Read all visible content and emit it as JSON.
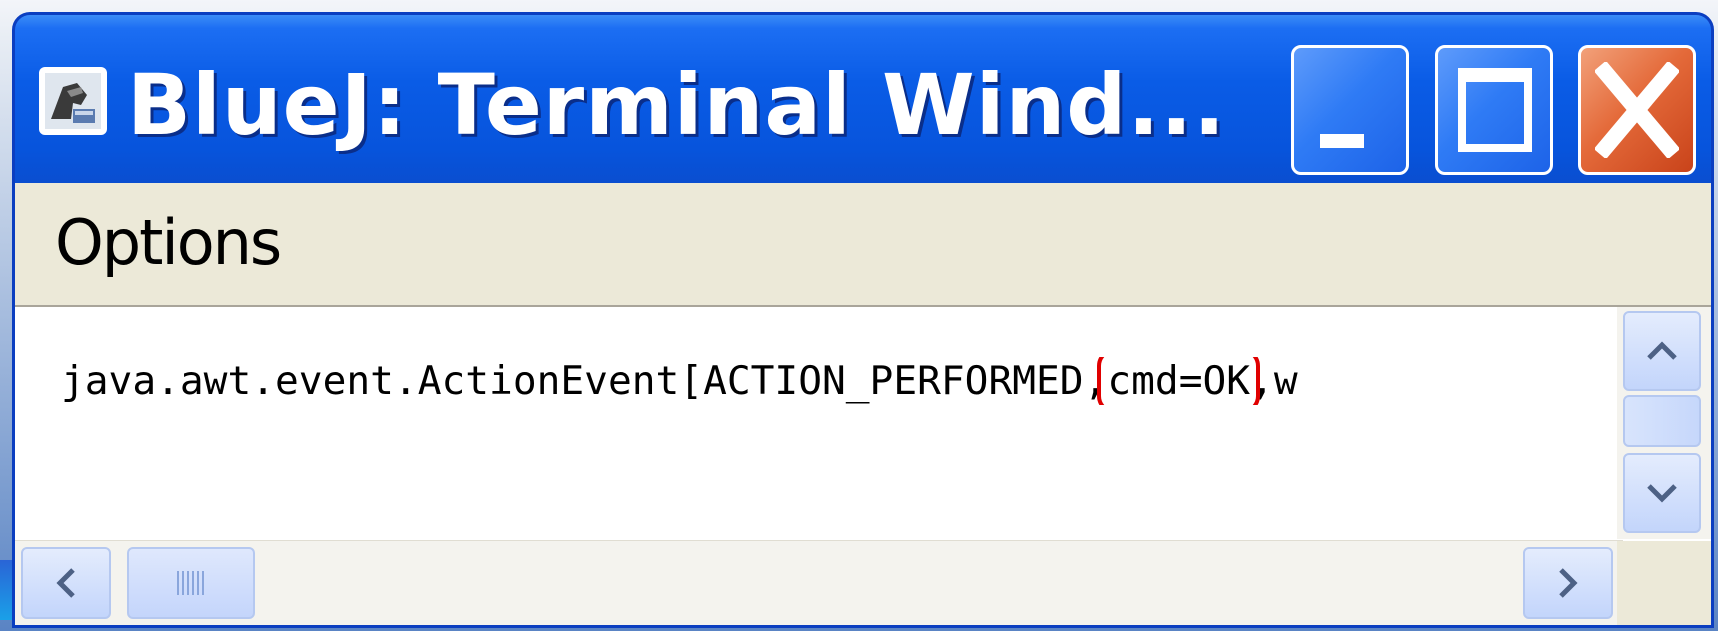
{
  "window": {
    "title": "BlueJ:  Terminal Wind...",
    "app_icon": "bluej-icon",
    "controls": {
      "minimize": "minimize-icon",
      "maximize": "maximize-icon",
      "close": "close-icon"
    }
  },
  "menubar": {
    "items": [
      {
        "label": "Options"
      }
    ]
  },
  "terminal": {
    "output_prefix": "java.awt.event.ActionEvent[ACTION_PERFORMED,",
    "output_highlight": "cmd=OK",
    "output_suffix": ",w"
  },
  "scrollbars": {
    "vertical": {
      "up": "chevron-up-icon",
      "down": "chevron-down-icon"
    },
    "horizontal": {
      "left": "chevron-left-icon",
      "right": "chevron-right-icon"
    }
  },
  "colors": {
    "titlebar": "#0a5ce6",
    "close_button": "#e46a3a",
    "highlight_box": "#e00000",
    "menubar": "#ece9d8"
  }
}
